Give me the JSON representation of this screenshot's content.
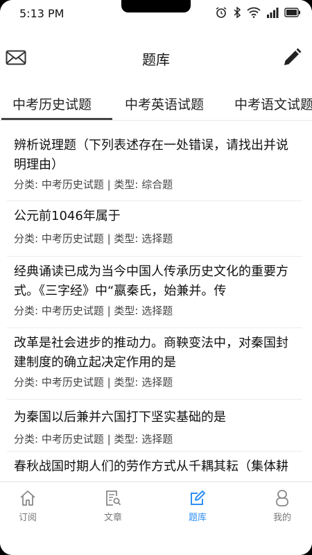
{
  "status_bar": {
    "time": "5:13 PM"
  },
  "header": {
    "title": "题库"
  },
  "tabs": [
    {
      "label": "中考历史试题"
    },
    {
      "label": "中考英语试题"
    },
    {
      "label": "中考语文试题"
    }
  ],
  "questions": [
    {
      "text": "辨析说理题（下列表述存在一处错误，请找出并说明理由）",
      "meta": "分类: 中考历史试题 | 类型: 综合题"
    },
    {
      "text": "公元前1046年属于",
      "meta": "分类: 中考历史试题 | 类型: 选择题"
    },
    {
      "text": "经典诵读已成为当今中国人传承历史文化的重要方式。《三字经》中“嬴秦氏，始兼并。传",
      "meta": "分类: 中考历史试题 | 类型: 选择题"
    },
    {
      "text": "改革是社会进步的推动力。商鞅变法中，对秦国封建制度的确立起决定作用的是",
      "meta": "分类: 中考历史试题 | 类型: 选择题"
    },
    {
      "text": "为秦国以后兼并六国打下坚实基础的是",
      "meta": "分类: 中考历史试题 | 类型: 选择题"
    },
    {
      "text": "春秋战国时期人们的劳作方式从千耦其耘（集体耕作）转变为个体农耕的主要原因是",
      "meta": ""
    }
  ],
  "bottom_nav": [
    {
      "label": "订阅",
      "icon": "home-icon"
    },
    {
      "label": "文章",
      "icon": "article-search-icon"
    },
    {
      "label": "题库",
      "icon": "edit-icon"
    },
    {
      "label": "我的",
      "icon": "person-icon"
    }
  ],
  "colors": {
    "active": "#2f8ff3",
    "inactive": "#777777"
  }
}
